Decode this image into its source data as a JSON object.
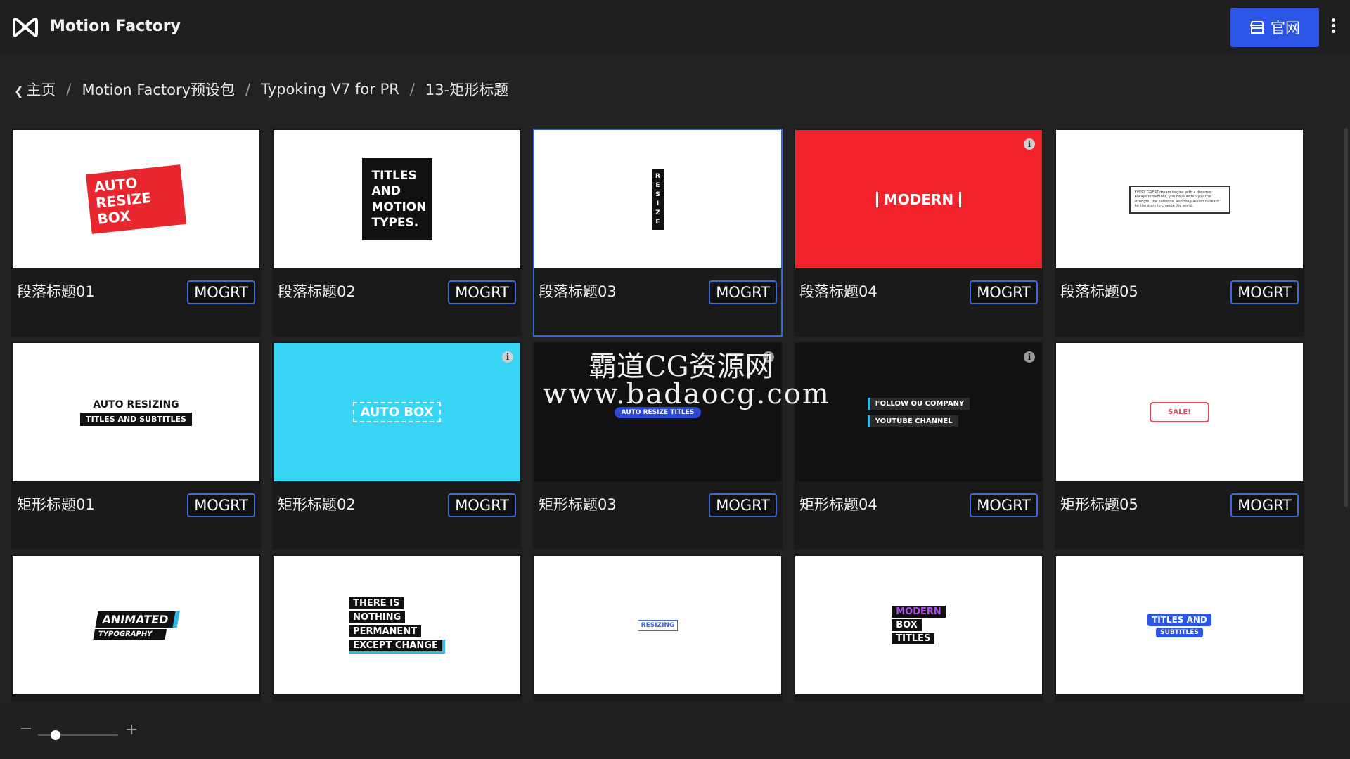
{
  "header": {
    "title": "Motion Factory",
    "site_button_label": "官网"
  },
  "breadcrumb": [
    "主页",
    "Motion Factory预设包",
    "Typoking V7 for PR",
    "13-矩形标题"
  ],
  "cards": [
    {
      "label": "段落标题01",
      "badge": "MOGRT",
      "art": [
        "AUTO RESIZE BOX"
      ]
    },
    {
      "label": "段落标题02",
      "badge": "MOGRT",
      "art": [
        "TITLES AND MOTION TYPES."
      ]
    },
    {
      "label": "段落标题03",
      "badge": "MOGRT",
      "art": [
        "R",
        "E",
        "S",
        "I",
        "Z",
        "E"
      ]
    },
    {
      "label": "段落标题04",
      "badge": "MOGRT",
      "art": [
        "MODERN"
      ]
    },
    {
      "label": "段落标题05",
      "badge": "MOGRT",
      "art": [
        "EVERY GREAT dream begins with a dreamer. Always remember, you have within you the strength, the patience, and the passion to reach for the stars to change the world."
      ]
    },
    {
      "label": "矩形标题01",
      "badge": "MOGRT",
      "art": [
        "AUTO RESIZING",
        "TITLES AND SUBTITLES"
      ]
    },
    {
      "label": "矩形标题02",
      "badge": "MOGRT",
      "art": [
        "AUTO BOX"
      ]
    },
    {
      "label": "矩形标题03",
      "badge": "MOGRT",
      "art": [
        "AUTO RESIZE TITLES"
      ]
    },
    {
      "label": "矩形标题04",
      "badge": "MOGRT",
      "art": [
        "FOLLOW OU COMPANY",
        "YOUTUBE CHANNEL"
      ]
    },
    {
      "label": "矩形标题05",
      "badge": "MOGRT",
      "art": [
        "SALE!"
      ]
    },
    {
      "art": [
        "ANIMATED",
        "TYPOGRAPHY"
      ]
    },
    {
      "art": [
        "THERE IS",
        "NOTHING",
        "PERMANENT",
        "EXCEPT CHANGE"
      ]
    },
    {
      "art": [
        "RESIZING"
      ]
    },
    {
      "art": [
        "MODERN",
        "BOX",
        "TITLES"
      ]
    },
    {
      "art": [
        "TITLES AND",
        "SUBTITLES"
      ]
    }
  ],
  "watermark": {
    "line1": "霸道CG资源网",
    "line2": "www.badaocg.com"
  },
  "zoom": {
    "level": 0.2
  },
  "colors": {
    "accent": "#2b55e6",
    "badge_border": "#3f6ad6",
    "red_thumb": "#f2232b",
    "cyan_thumb": "#39d5f5"
  }
}
